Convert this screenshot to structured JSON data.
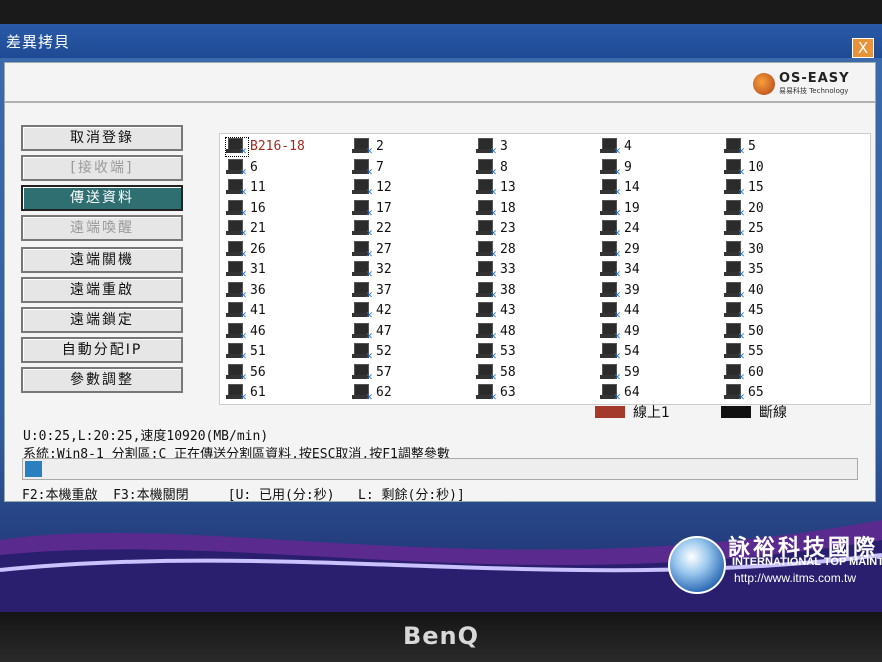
{
  "window": {
    "title": "差異拷貝",
    "close_label": "X"
  },
  "logo": {
    "name": "OS-EASY",
    "subtitle": "易易科技 Technology"
  },
  "buttons": [
    {
      "label": "取消登錄",
      "state": "normal"
    },
    {
      "label": "[接收端]",
      "state": "disabled"
    },
    {
      "label": "傳送資料",
      "state": "active"
    },
    {
      "label": "遠端喚醒",
      "state": "disabled"
    },
    {
      "label": "遠端關機",
      "state": "normal"
    },
    {
      "label": "遠端重啟",
      "state": "normal"
    },
    {
      "label": "遠端鎖定",
      "state": "normal"
    },
    {
      "label": "自動分配IP",
      "state": "normal"
    },
    {
      "label": "參數調整",
      "state": "normal"
    }
  ],
  "clients": [
    "B216-18",
    "2",
    "3",
    "4",
    "5",
    "6",
    "7",
    "8",
    "9",
    "10",
    "11",
    "12",
    "13",
    "14",
    "15",
    "16",
    "17",
    "18",
    "19",
    "20",
    "21",
    "22",
    "23",
    "24",
    "25",
    "26",
    "27",
    "28",
    "29",
    "30",
    "31",
    "32",
    "33",
    "34",
    "35",
    "36",
    "37",
    "38",
    "39",
    "40",
    "41",
    "42",
    "43",
    "44",
    "45",
    "46",
    "47",
    "48",
    "49",
    "50",
    "51",
    "52",
    "53",
    "54",
    "55",
    "56",
    "57",
    "58",
    "59",
    "60",
    "61",
    "62",
    "63",
    "64",
    "65"
  ],
  "legend": [
    {
      "label": "線上1",
      "color": "#a33a2c"
    },
    {
      "label": "斷線",
      "color": "#111111"
    }
  ],
  "status": {
    "line1": "U:0:25,L:20:25,速度10920(MB/min)",
    "line2": "系統:Win8-1 分割區:C 正在傳送分割區資料,按ESC取消,按F1調整參數",
    "progress_fraction": 0.02,
    "hints": "F2:本機重啟  F3:本機關閉     [U: 已用(分:秒)   L: 剩餘(分:秒)]"
  },
  "brand": {
    "title": "詠裕科技國際",
    "subtitle": "INTERNATIONAL TOP MAINTENANCE",
    "url": "http://www.itms.com.tw"
  },
  "monitor": {
    "brand": "BenQ"
  }
}
